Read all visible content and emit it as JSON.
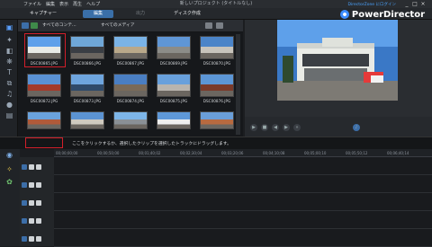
{
  "menu": {
    "items": [
      "ファイル",
      "編集",
      "表示",
      "再生",
      "ヘルプ"
    ]
  },
  "window": {
    "title": "新しいプロジェクト (タイトルなし)",
    "user_link": "DirectorZone にログイン",
    "controls": [
      "_",
      "□",
      "×"
    ]
  },
  "modes": {
    "capture": "キャプチャー",
    "edit": "編集",
    "produce": "出力",
    "disc": "ディスク作成"
  },
  "brand": {
    "name": "PowerDirector"
  },
  "library": {
    "filter_content": "すべてのコンテ...",
    "filter_media": "すべてのメディア",
    "thumbnails": [
      {
        "label": "DSC00865.JPG",
        "selected": true
      },
      {
        "label": "DSC00866.JPG"
      },
      {
        "label": "DSC00867.JPG"
      },
      {
        "label": "DSC00869.JPG"
      },
      {
        "label": "DSC00870.JPG"
      },
      {
        "label": "DSC00872.JPG"
      },
      {
        "label": "DSC00873.JPG"
      },
      {
        "label": "DSC00874.JPG"
      },
      {
        "label": "DSC00875.JPG"
      },
      {
        "label": "DSC00876.JPG"
      },
      {
        "label": "",
        "partial": true
      },
      {
        "label": "",
        "partial": true
      },
      {
        "label": "",
        "partial": true
      },
      {
        "label": "",
        "partial": true
      },
      {
        "label": "",
        "partial": true
      }
    ]
  },
  "timeline": {
    "hint": "ここをクリックするか、選択したクリップを選択したトラックにドラッグします。",
    "ruler": [
      "00;00;00;00",
      "00;00;50;00",
      "00;01;40;02",
      "00;02;30;04",
      "00;03;20;06",
      "00;04;10;08",
      "00;05;00;10",
      "00;05;50;12",
      "00;06;40;14"
    ],
    "track_count": 5
  },
  "colors": {
    "accent": "#3a6fa8",
    "highlight": "#d21f2a",
    "link": "#4aa3ff"
  }
}
